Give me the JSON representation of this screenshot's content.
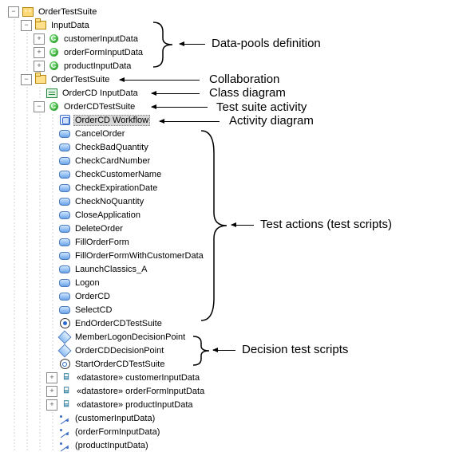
{
  "tree": {
    "root": "OrderTestSuite",
    "inputData": {
      "label": "InputData",
      "items": [
        "customerInputData",
        "orderFormInputData",
        "productInputData"
      ]
    },
    "collab": {
      "label": "OrderTestSuite",
      "classDiagram": "OrderCD InputData",
      "suite": {
        "label": "OrderCDTestSuite",
        "activity": "OrderCD Workflow",
        "actions": [
          "CancelOrder",
          "CheckBadQuantity",
          "CheckCardNumber",
          "CheckCustomerName",
          "CheckExpirationDate",
          "CheckNoQuantity",
          "CloseApplication",
          "DeleteOrder",
          "FillOrderForm",
          "FillOrderFormWithCustomerData",
          "LaunchClassics_A",
          "Logon",
          "OrderCD",
          "SelectCD"
        ],
        "end": "EndOrderCDTestSuite",
        "decisions": [
          "MemberLogonDecisionPoint",
          "OrderCDDecisionPoint"
        ],
        "start": "StartOrderCDTestSuite",
        "datastores": [
          "«datastore» customerInputData",
          "«datastore» orderFormInputData",
          "«datastore» productInputData"
        ],
        "links": [
          "(customerInputData)",
          "(orderFormInputData)",
          "(productInputData)"
        ]
      }
    }
  },
  "ann": {
    "datapools": "Data-pools definition",
    "collab": "Collaboration",
    "classdiag": "Class diagram",
    "testsuiteact": "Test suite activity",
    "activitydiag": "Activity diagram",
    "testactions": "Test actions (test scripts)",
    "decision": "Decision test scripts"
  }
}
